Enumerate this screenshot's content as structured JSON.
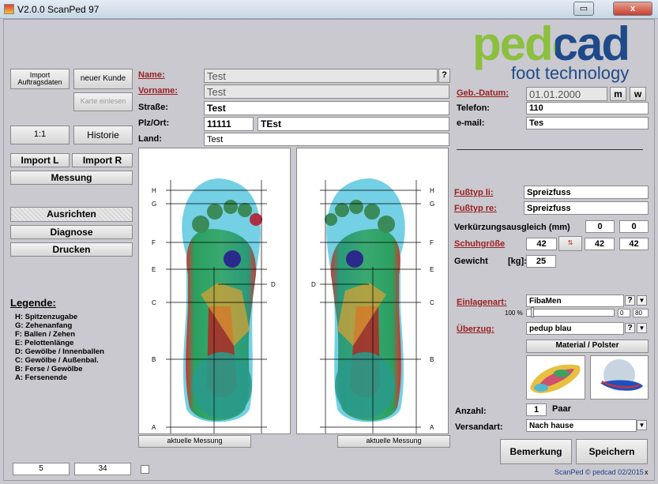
{
  "window": {
    "title": "V2.0.0 ScanPed 97",
    "restore_glyph": "▭",
    "close_glyph": "x"
  },
  "left": {
    "import_auftragsdaten": "Import Auftragsdaten",
    "neuer_kunde": "neuer Kunde",
    "karte_einlesen": "Karte einlesen",
    "scale": "1:1",
    "historie": "Historie",
    "import_l": "Import L",
    "import_r": "Import R",
    "messung": "Messung",
    "ausrichten": "Ausrichten",
    "diagnose": "Diagnose",
    "drucken": "Drucken",
    "legend_title": "Legende:",
    "legend_items": [
      "H: Spitzenzugabe",
      "G: Zehenanfang",
      "F: Ballen / Zehen",
      "E: Pelottenlänge",
      "D: Gewölbe / Innenballen",
      "C: Gewölbe / Außenbal.",
      "B: Ferse / Gewölbe",
      "A: Fersenende"
    ],
    "field1": "5",
    "field2": "34"
  },
  "customer": {
    "name_label": "Name:",
    "name_value": "Test",
    "help": "?",
    "vorname_label": "Vorname:",
    "vorname_value": "Test",
    "strasse_label": "Straße:",
    "strasse_value": "Test",
    "plz_label": "Plz/Ort:",
    "plz_value": "11111",
    "ort_value": "TEst",
    "land_label": "Land:",
    "land_value": "Test"
  },
  "contact": {
    "geb_label": "Geb.-Datum:",
    "geb_value": "01.01.2000",
    "m": "m",
    "w": "w",
    "telefon_label": "Telefon:",
    "telefon_value": "110",
    "email_label": "e-mail:",
    "email_value": "Tes"
  },
  "logo": {
    "brand": "pedcad",
    "tagline": "foot technology",
    "green": "#8cbf3e",
    "blue": "#1f4a8a"
  },
  "scan": {
    "lines": [
      "H",
      "G",
      "F",
      "E",
      "D",
      "C",
      "B",
      "A"
    ],
    "aktuelle_left": "aktuelle Messung",
    "aktuelle_right": "aktuelle Messung"
  },
  "order": {
    "fusstyp_li_label": "Fußtyp li:",
    "fusstyp_li_value": "Spreizfuss",
    "fusstyp_re_label": "Fußtyp re:",
    "fusstyp_re_value": "Spreizfuss",
    "verk_label": "Verkürzungsausgleich (mm)",
    "verk_l": "0",
    "verk_r": "0",
    "schuh_label": "Schuhgröße",
    "schuh_1": "42",
    "schuh_2": "42",
    "schuh_3": "42",
    "gewicht_label": "Gewicht",
    "kg_label": "[kg]:",
    "gewicht_value": "25",
    "einlagen_label": "Einlagenart:",
    "einlagen_value": "FibaMen",
    "slider_pct": "100 %",
    "slider_val": "0",
    "slider_max": "80",
    "ueberzug_label": "Überzug:",
    "ueberzug_value": "pedup blau",
    "material": "Material / Polster",
    "anzahl_label": "Anzahl:",
    "anzahl_value": "1",
    "paar": "Paar",
    "versand_label": "Versandart:",
    "versand_value": "Nach hause",
    "bemerkung": "Bemerkung",
    "speichern": "Speichern",
    "status": "ScanPed © pedcad 02/2015",
    "status_x": "x"
  }
}
